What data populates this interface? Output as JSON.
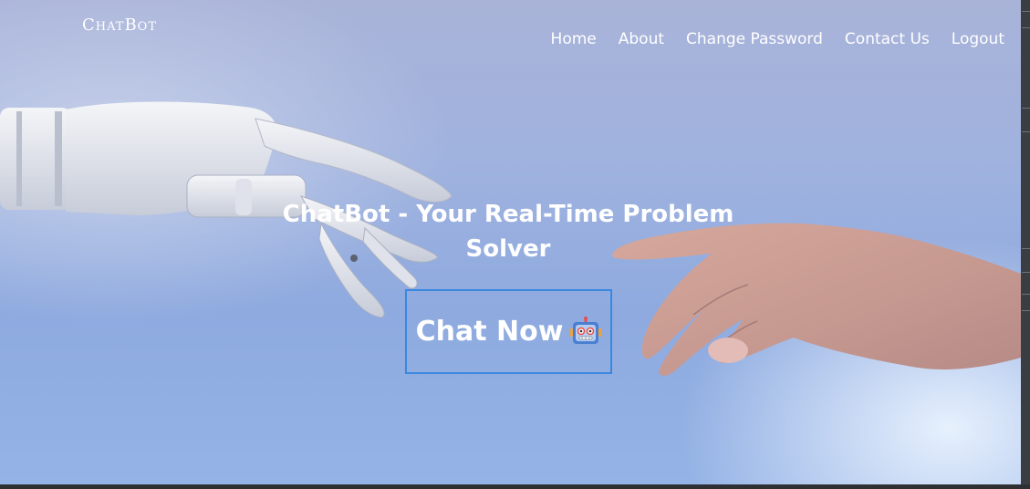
{
  "brand": "ChatBot",
  "nav": {
    "items": [
      "Home",
      "About",
      "Change Password",
      "Contact Us",
      "Logout"
    ]
  },
  "hero": {
    "title": "ChatBot - Your Real-Time Problem Solver",
    "cta_label": "Chat Now",
    "cta_icon": "robot-face-icon"
  },
  "colors": {
    "accent_border": "#3a87e0",
    "text": "#ffffff"
  }
}
